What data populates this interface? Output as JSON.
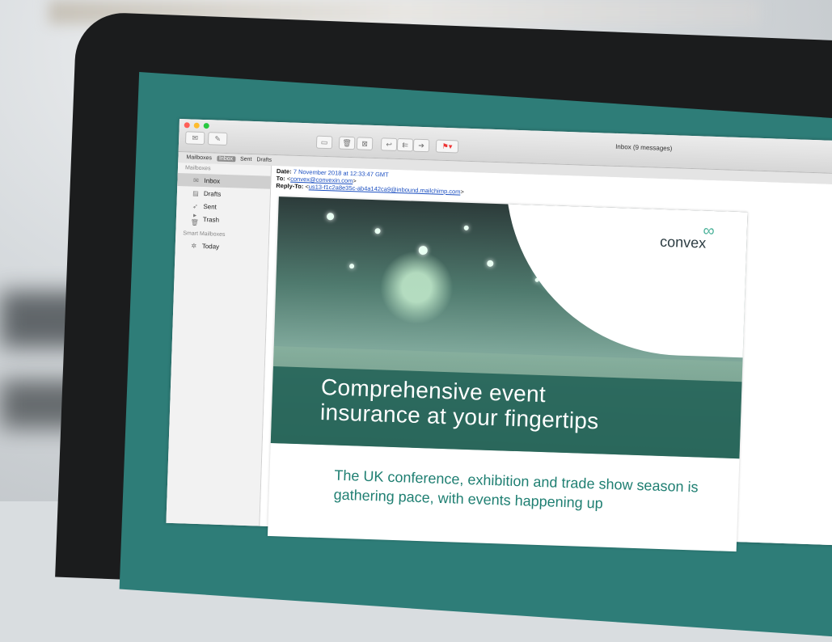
{
  "window": {
    "title": "Inbox (9 messages)",
    "tabs": [
      "Mailboxes",
      "Inbox",
      "Sent",
      "Drafts"
    ]
  },
  "sidebar": {
    "section1": "Mailboxes",
    "items": [
      {
        "label": "Inbox",
        "icon": "inbox-icon"
      },
      {
        "label": "Drafts",
        "icon": "drafts-icon"
      },
      {
        "label": "Sent",
        "icon": "sent-icon"
      },
      {
        "label": "Trash",
        "icon": "trash-icon"
      }
    ],
    "section2": "Smart Mailboxes",
    "smart_items": [
      {
        "label": "Today",
        "icon": "gear-icon"
      }
    ]
  },
  "message": {
    "date_label": "Date:",
    "date_value": "7 November 2018 at 12:33:47 GMT",
    "to_label": "To:",
    "to_value": "convex@convexin.com",
    "reply_label": "Reply-To:",
    "reply_value": "us13-f1c2a8e35c-ab4a142ca9@inbound.mailchimp.com"
  },
  "newsletter": {
    "logo": "convex",
    "headline_1": "Comprehensive event",
    "headline_2": "insurance at your fingertips",
    "lead": "The UK conference, exhibition and trade show season is gathering pace, with events happening up"
  },
  "colors": {
    "accent": "#2e7d78",
    "headline_band": "#1e5f55",
    "lead_text": "#1f7f72",
    "link": "#1b4fc1"
  }
}
